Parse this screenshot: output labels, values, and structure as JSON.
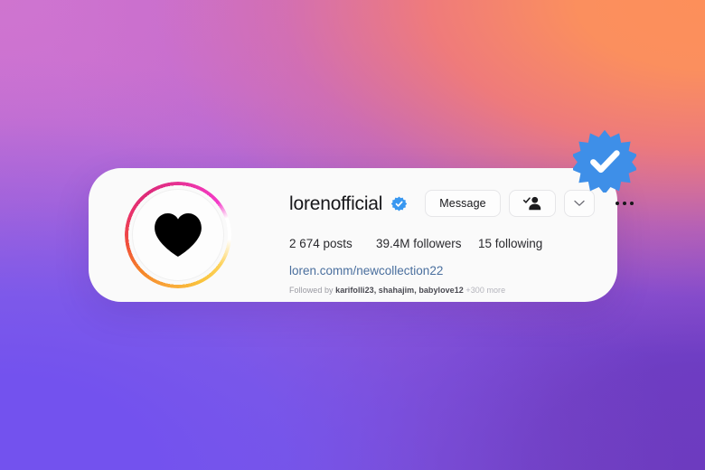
{
  "theme": {
    "background_colors": [
      "#cf74cf",
      "#fb8f5e",
      "#7352ee",
      "#6d3bbf"
    ],
    "card_background": "#fafafa",
    "verified_blue": "#3897f0",
    "link_color": "#4a6f9e",
    "ring_gradient": [
      "#f9c23c",
      "#f58529",
      "#dd2a7b",
      "#f33bc8"
    ]
  },
  "profile": {
    "username": "lorenofficial",
    "verified": true,
    "avatar_icon": "heart-icon",
    "stats": [
      {
        "id": "posts",
        "text": "2 674 posts"
      },
      {
        "id": "followers",
        "text": "39.4M followers"
      },
      {
        "id": "following",
        "text": "15 following"
      }
    ],
    "link": "loren.comm/newcollection22",
    "followed_by": {
      "prefix": "Followed by",
      "names": "karifolli23, shahajim, babylove12",
      "more": "+300 more"
    }
  },
  "actions": {
    "message_label": "Message",
    "following_icon": "person-check-icon",
    "caret_icon": "chevron-down-icon",
    "more_icon": "ellipsis-icon"
  },
  "badge": {
    "large_icon": "verified-starburst-icon",
    "small_icon": "verified-badge-icon"
  }
}
